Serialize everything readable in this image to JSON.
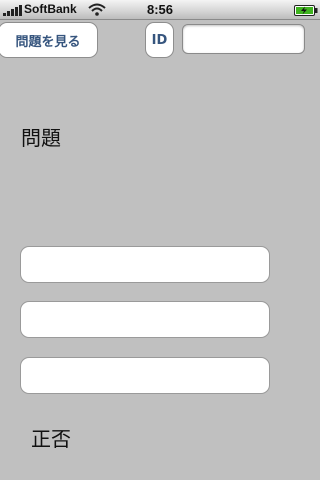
{
  "status_bar": {
    "carrier": "SoftBank",
    "time": "8:56",
    "icons": [
      "signal-icon",
      "wifi-icon",
      "battery-charging-icon"
    ]
  },
  "toolbar": {
    "view_problem_label": "問題を見る",
    "id_label": "ID",
    "id_field_value": ""
  },
  "main": {
    "problem_label": "問題",
    "answer_fields": [
      "",
      "",
      ""
    ],
    "result_label": "正否"
  }
}
